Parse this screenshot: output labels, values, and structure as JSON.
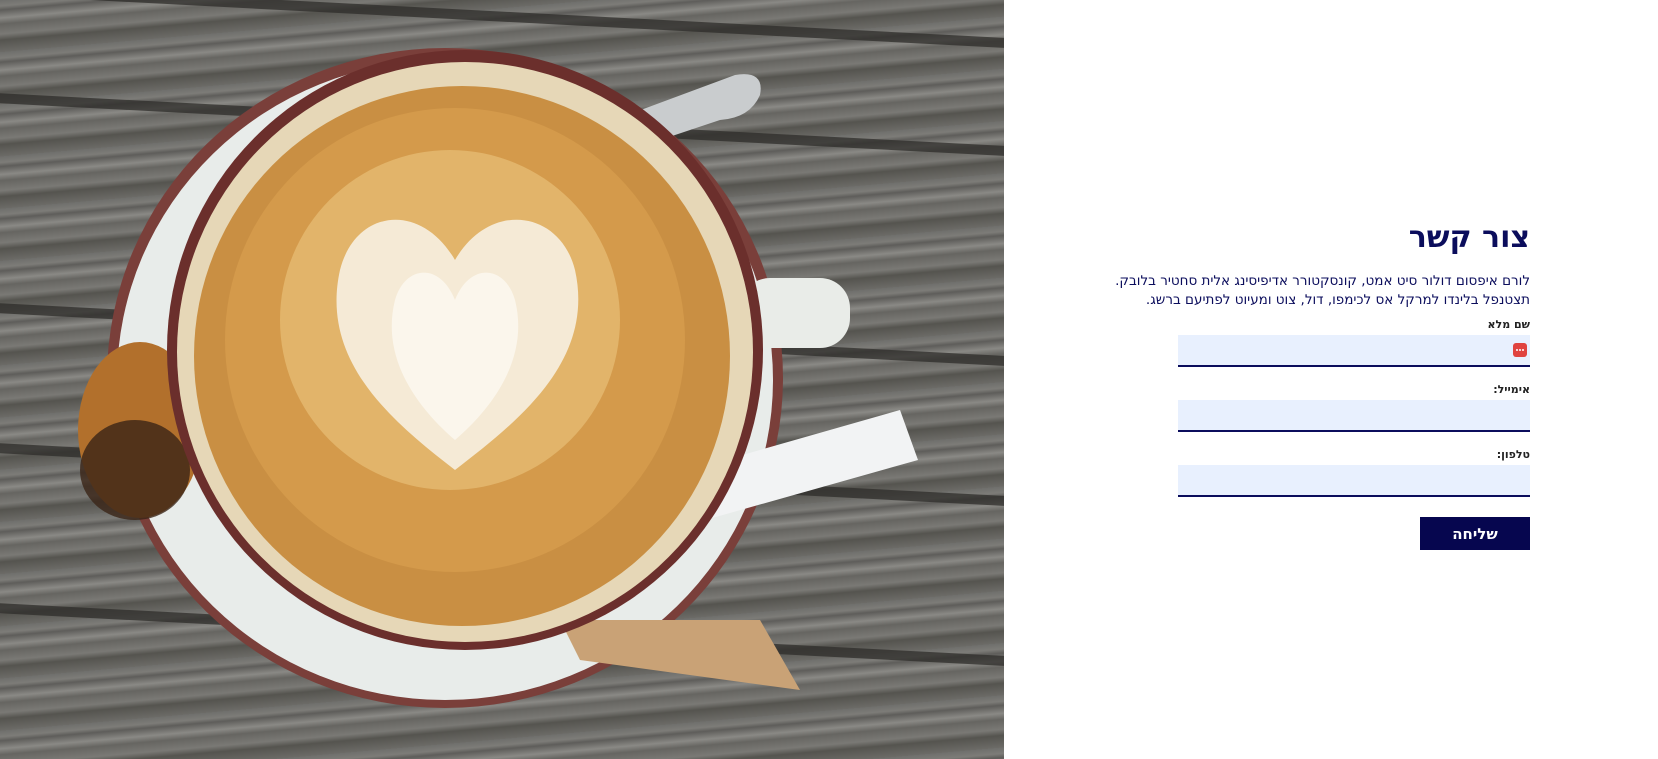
{
  "photo": {
    "alt_subject": "latte-art-coffee-cup"
  },
  "contact": {
    "title": "צור קשר",
    "description_line1": "לורם איפסום דולור סיט אמט, קונסקטורר אדיפיסינג אלית סחטיר בלובק.",
    "description_line2": "תצטנפל בלינדו למרקל אס לכימפו, דול, צוט ומעיוט לפתיעם ברשג.",
    "fields": [
      {
        "label": "שם מלא",
        "value": ""
      },
      {
        "label": "אימייל:",
        "value": ""
      },
      {
        "label": "טלפון:",
        "value": ""
      }
    ],
    "submit_label": "שליחה"
  },
  "colors": {
    "primary": "#0b0d5c",
    "button": "#06064f",
    "input_bg": "#e8f0fe",
    "autofill_icon": "#e0433f"
  }
}
